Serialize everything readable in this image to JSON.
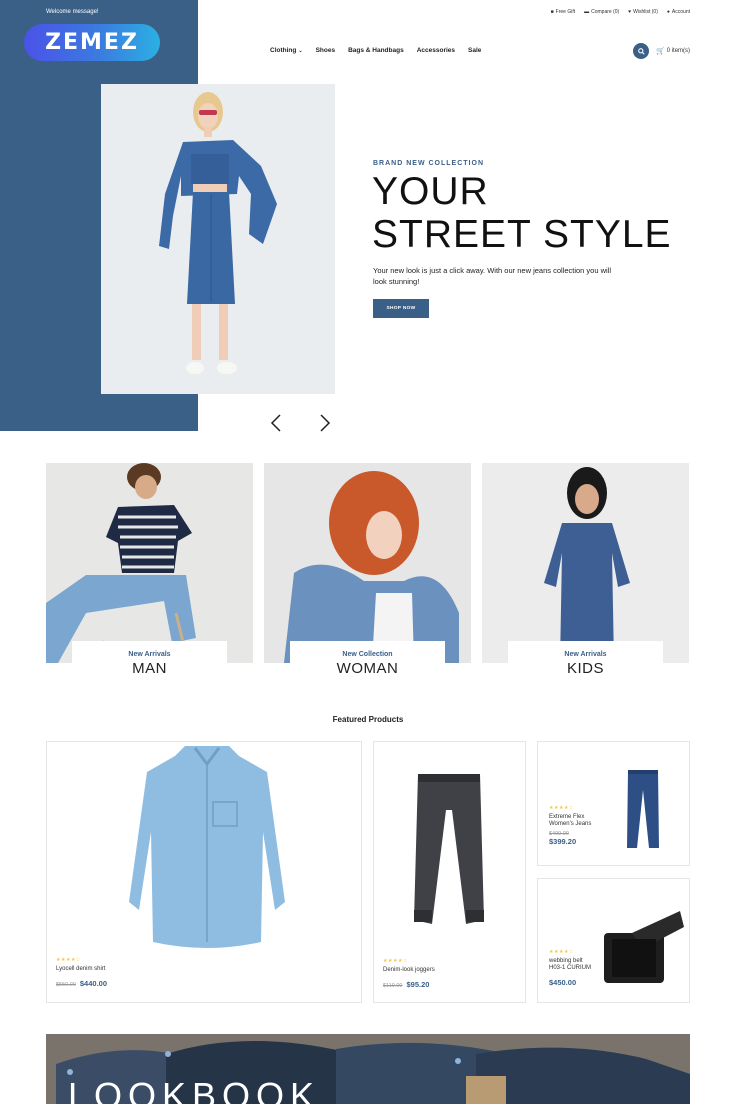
{
  "header": {
    "welcome": "Welcome message!",
    "logo": "ZEMEZ",
    "top_links": [
      {
        "label": "Free Gift",
        "icon": "gift-icon"
      },
      {
        "label": "Compare (0)",
        "icon": "compare-icon"
      },
      {
        "label": "Wishlist (0)",
        "icon": "heart-icon"
      },
      {
        "label": "Account",
        "icon": "user-icon"
      }
    ],
    "nav": [
      "Clothing",
      "Shoes",
      "Bags & Handbags",
      "Accessories",
      "Sale"
    ],
    "cart": "0 item(s)"
  },
  "hero": {
    "kicker": "BRAND NEW COLLECTION",
    "title_line1": "YOUR",
    "title_line2": "STREET STYLE",
    "text": "Your new look is just a click away. With our new jeans collection you will look stunning!",
    "button": "SHOP NOW"
  },
  "categories": [
    {
      "sub": "New Arrivals",
      "main": "MAN"
    },
    {
      "sub": "New Collection",
      "main": "WOMAN"
    },
    {
      "sub": "New Arrivals",
      "main": "KIDS"
    }
  ],
  "featured": {
    "title": "Featured Products",
    "products": [
      {
        "name": "Lyocell denim shirt",
        "old_price": "$550.00",
        "price": "$440.00",
        "rating": 4
      },
      {
        "name": "Denim-look joggers",
        "old_price": "$119.00",
        "price": "$95.20",
        "rating": 4
      },
      {
        "name": "Extreme Flex Women's Jeans",
        "old_price": "$499.00",
        "price": "$399.20",
        "rating": 4
      },
      {
        "name": "webbing belt H03-1 CURIUM",
        "old_price": "",
        "price": "$450.00",
        "rating": 4
      }
    ]
  },
  "lookbook": {
    "title": "LOOKBOOK"
  },
  "colors": {
    "brand_blue": "#3a6088",
    "star": "#f2c744"
  }
}
